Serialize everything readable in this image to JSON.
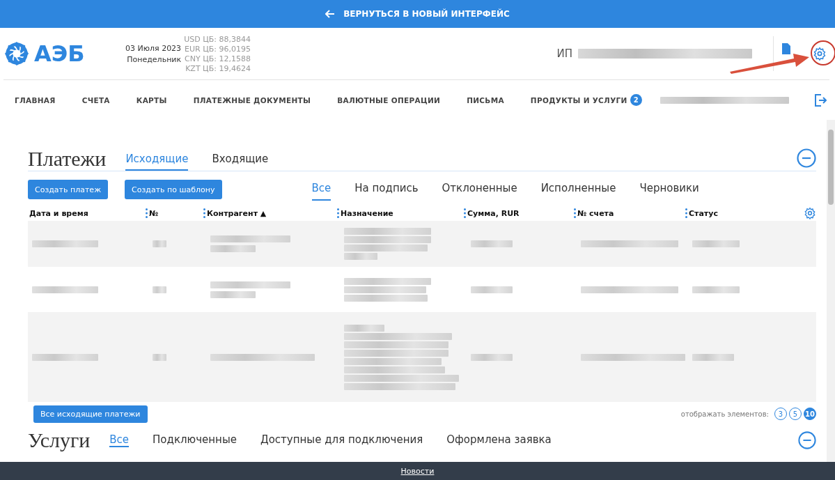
{
  "top_banner": {
    "text": "ВЕРНУТЬСЯ В НОВЫЙ ИНТЕРФЕЙС"
  },
  "header": {
    "logo": "АЭБ",
    "date": "03 Июля 2023",
    "weekday": "Понедельник",
    "rates": [
      "USD ЦБ: 88,3844",
      "EUR ЦБ: 96,0195",
      "CNY ЦБ: 12,1588",
      "KZT ЦБ: 19,4624"
    ],
    "user_prefix": "ИП"
  },
  "nav": {
    "items": [
      {
        "label": "ГЛАВНАЯ"
      },
      {
        "label": "СЧЕТА"
      },
      {
        "label": "КАРТЫ"
      },
      {
        "label": "ПЛАТЕЖНЫЕ ДОКУМЕНТЫ"
      },
      {
        "label": "ВАЛЮТНЫЕ ОПЕРАЦИИ"
      },
      {
        "label": "ПИСЬМА"
      },
      {
        "label": "ПРОДУКТЫ И УСЛУГИ",
        "badge": "2"
      }
    ]
  },
  "payments": {
    "title": "Платежи",
    "tabs": [
      {
        "label": "Исходящие",
        "selected": true
      },
      {
        "label": "Входящие",
        "selected": false
      }
    ],
    "buttons": [
      "Создать платеж",
      "Создать по шаблону"
    ],
    "filters": [
      {
        "label": "Все",
        "selected": true
      },
      {
        "label": "На подпись",
        "selected": false
      },
      {
        "label": "Отклоненные",
        "selected": false
      },
      {
        "label": "Исполненные",
        "selected": false
      },
      {
        "label": "Черновики",
        "selected": false
      }
    ],
    "columns": [
      "Дата и время",
      "№",
      "Контрагент ▲",
      "Назначение",
      "Сумма, RUR",
      "№ счета",
      "Статус"
    ],
    "all_button": "Все исходящие платежи",
    "page_size": {
      "label": "отображать элементов:",
      "options": [
        {
          "label": "3",
          "selected": false
        },
        {
          "label": "5",
          "selected": false
        },
        {
          "label": "10",
          "selected": true
        }
      ]
    }
  },
  "services": {
    "title": "Услуги",
    "tabs": [
      {
        "label": "Все",
        "selected": true
      },
      {
        "label": "Подключенные",
        "selected": false
      },
      {
        "label": "Доступные для подключения",
        "selected": false
      },
      {
        "label": "Оформлена заявка",
        "selected": false
      }
    ]
  },
  "footer": {
    "link": "Новости"
  }
}
